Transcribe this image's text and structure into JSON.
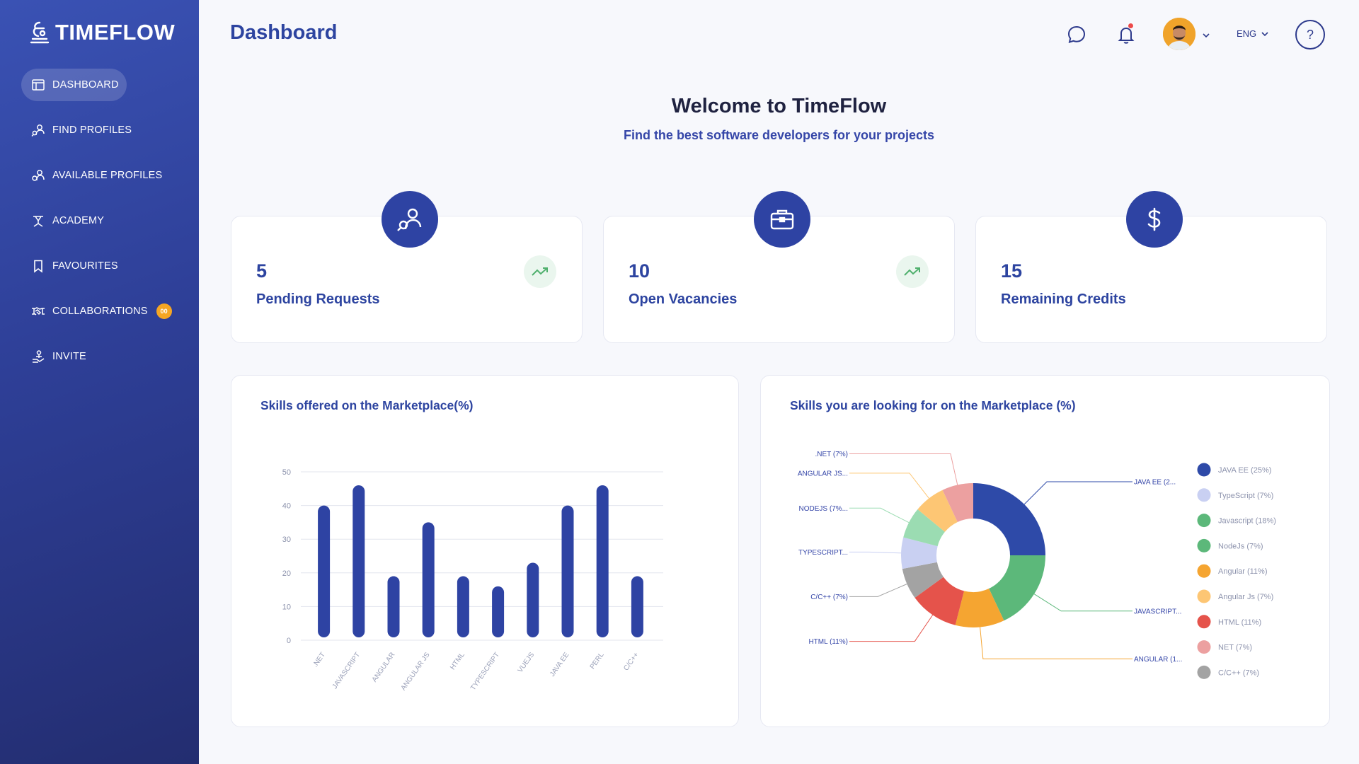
{
  "app": {
    "logo_text": "TIMEFLOW"
  },
  "sidebar": {
    "items": [
      {
        "label": "DASHBOARD",
        "icon": "dashboard-icon",
        "active": true
      },
      {
        "label": "FIND PROFILES",
        "icon": "find-profiles-icon"
      },
      {
        "label": "AVAILABLE PROFILES",
        "icon": "available-profiles-icon"
      },
      {
        "label": "ACADEMY",
        "icon": "academy-icon"
      },
      {
        "label": "FAVOURITES",
        "icon": "bookmark-icon"
      },
      {
        "label": "COLLABORATIONS",
        "icon": "handshake-icon",
        "badge": "00"
      },
      {
        "label": "INVITE",
        "icon": "invite-icon"
      }
    ]
  },
  "header": {
    "title": "Dashboard",
    "language": "ENG",
    "help_label": "?"
  },
  "welcome": {
    "title": "Welcome to TimeFlow",
    "subtitle": "Find the best software developers for your projects"
  },
  "stats": [
    {
      "value": "5",
      "label": "Pending Requests",
      "icon": "find-profiles-icon",
      "trend": true
    },
    {
      "value": "10",
      "label": "Open Vacancies",
      "icon": "briefcase-icon",
      "trend": true
    },
    {
      "value": "15",
      "label": "Remaining Credits",
      "icon": "dollar-icon",
      "trend": false
    }
  ],
  "colors": {
    "primary": "#2e43a3",
    "accent": "#f5a623",
    "trend_bg": "#eaf6ee",
    "trend": "#4fb06d"
  },
  "chart_data": [
    {
      "type": "bar",
      "title": "Skills offered on the Marketplace(%)",
      "categories": [
        ".NET",
        "JAVASCRIPT",
        "ANGULAR",
        "ANGULAR JS",
        "HTML",
        "TYPESCRIPT",
        "VUEJS",
        "JAVA EE",
        "PERL",
        "C/C++"
      ],
      "values": [
        40,
        46,
        19,
        35,
        19,
        16,
        23,
        40,
        46,
        19
      ],
      "ylim": [
        0,
        50
      ],
      "yticks": [
        0,
        10,
        20,
        30,
        40,
        50
      ],
      "grid": true,
      "color": "#2e43a3"
    },
    {
      "type": "pie",
      "title": "Skills you are looking for on the Marketplace (%)",
      "slices": [
        {
          "name": "JAVA EE (25%)",
          "value": 25,
          "color": "#2e4aa8",
          "callout": "JAVA EE (2..."
        },
        {
          "name": "Javascript (18%)",
          "value": 18,
          "color": "#5cb87a",
          "callout": "JAVASCRIPT..."
        },
        {
          "name": "Angular (11%)",
          "value": 11,
          "color": "#f5a531",
          "callout": "ANGULAR (1..."
        },
        {
          "name": "HTML (11%)",
          "value": 11,
          "color": "#e5534b",
          "callout": "HTML (11%)"
        },
        {
          "name": "C/C++ (7%)",
          "value": 7,
          "color": "#a3a3a3",
          "callout": "C/C++ (7%)"
        },
        {
          "name": "TypeScript (7%)",
          "value": 7,
          "color": "#c9d0f2",
          "callout": "TYPESCRIPT..."
        },
        {
          "name": "NodeJs (7%)",
          "value": 7,
          "color": "#9bdcb2",
          "callout": "NODEJS (7%..."
        },
        {
          "name": "Angular Js (7%)",
          "value": 7,
          "color": "#fdc674",
          "callout": "ANGULAR JS..."
        },
        {
          "name": "NET (7%)",
          "value": 7,
          "color": "#eca0a0",
          "callout": ".NET (7%)"
        }
      ],
      "legend_order": [
        "JAVA EE (25%)",
        "TypeScript (7%)",
        "Javascript (18%)",
        "NodeJs (7%)",
        "Angular (11%)",
        "Angular Js (7%)",
        "HTML (11%)",
        "NET (7%)",
        "C/C++ (7%)"
      ],
      "legend_colors": [
        "#2e4aa8",
        "#c9d0f2",
        "#5cb87a",
        "#5cb87a",
        "#f5a531",
        "#fdc674",
        "#e5534b",
        "#eca0a0",
        "#a3a3a3"
      ],
      "legend": "right"
    }
  ]
}
